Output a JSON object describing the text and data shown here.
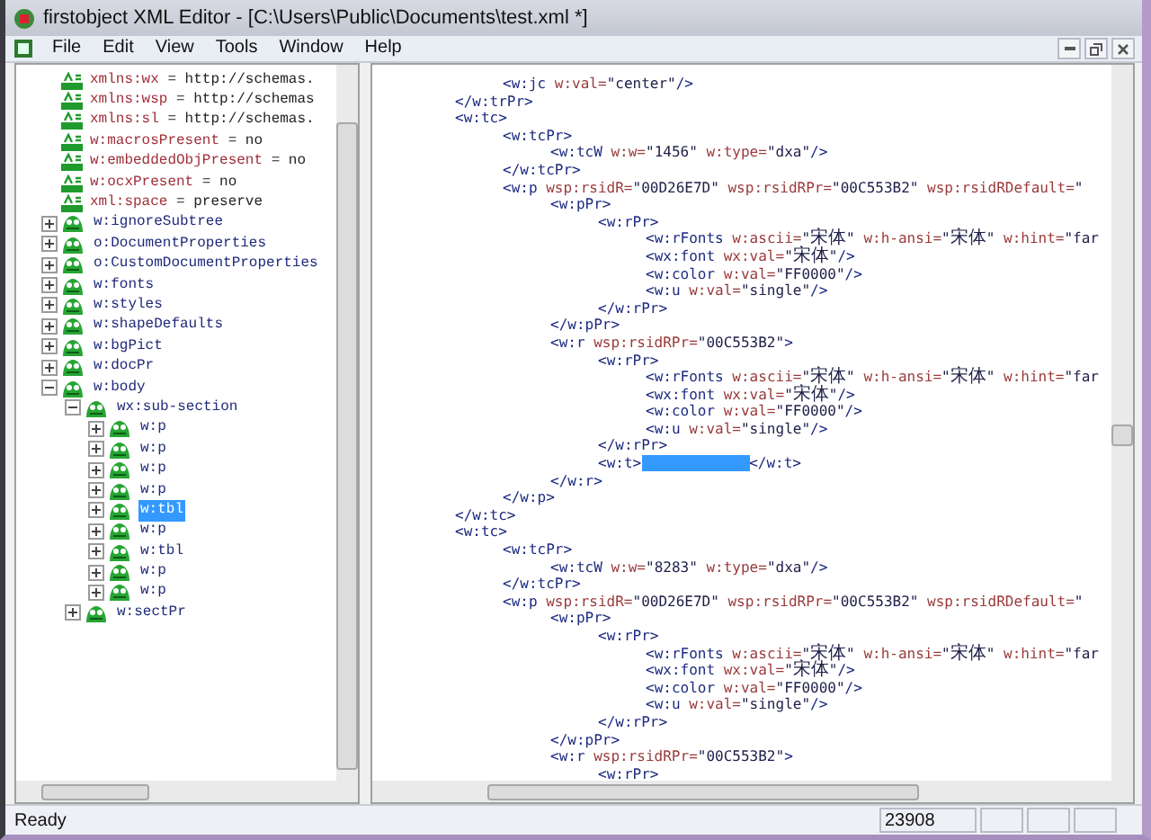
{
  "window": {
    "title": "firstobject XML Editor - [C:\\Users\\Public\\Documents\\test.xml *]"
  },
  "menu": [
    "File",
    "Edit",
    "View",
    "Tools",
    "Window",
    "Help"
  ],
  "tree": [
    {
      "kind": "attribute",
      "name": "xmlns:wx",
      "value": " = http://schemas."
    },
    {
      "kind": "attribute",
      "name": "xmlns:wsp",
      "value": " = http://schemas"
    },
    {
      "kind": "attribute",
      "name": "xmlns:sl",
      "value": " = http://schemas."
    },
    {
      "kind": "attribute",
      "name": "w:macrosPresent",
      "value": " = no"
    },
    {
      "kind": "attribute",
      "name": "w:embeddedObjPresent",
      "value": " = no"
    },
    {
      "kind": "attribute",
      "name": "w:ocxPresent",
      "value": " = no"
    },
    {
      "kind": "attribute",
      "name": "xml:space",
      "value": " = preserve"
    },
    {
      "kind": "element",
      "label": "w:ignoreSubtree",
      "expanded": false,
      "selected": false
    },
    {
      "kind": "element",
      "label": "o:DocumentProperties",
      "expanded": false,
      "selected": false
    },
    {
      "kind": "element",
      "label": "o:CustomDocumentProperties",
      "expanded": false,
      "selected": false
    },
    {
      "kind": "element",
      "label": "w:fonts",
      "expanded": false,
      "selected": false
    },
    {
      "kind": "element",
      "label": "w:styles",
      "expanded": false,
      "selected": false
    },
    {
      "kind": "element",
      "label": "w:shapeDefaults",
      "expanded": false,
      "selected": false
    },
    {
      "kind": "element",
      "label": "w:bgPict",
      "expanded": false,
      "selected": false
    },
    {
      "kind": "element",
      "label": "w:docPr",
      "expanded": false,
      "selected": false
    },
    {
      "kind": "element",
      "label": "w:body",
      "expanded": true,
      "selected": false,
      "children": [
        {
          "kind": "element",
          "label": "wx:sub-section",
          "expanded": true,
          "selected": false,
          "children": [
            {
              "kind": "element",
              "label": "w:p",
              "expanded": false,
              "selected": false
            },
            {
              "kind": "element",
              "label": "w:p",
              "expanded": false,
              "selected": false
            },
            {
              "kind": "element",
              "label": "w:p",
              "expanded": false,
              "selected": false
            },
            {
              "kind": "element",
              "label": "w:p",
              "expanded": false,
              "selected": false
            },
            {
              "kind": "element",
              "label": "w:tbl",
              "expanded": false,
              "selected": true
            },
            {
              "kind": "element",
              "label": "w:p",
              "expanded": false,
              "selected": false
            },
            {
              "kind": "element",
              "label": "w:tbl",
              "expanded": false,
              "selected": false
            },
            {
              "kind": "element",
              "label": "w:p",
              "expanded": false,
              "selected": false
            },
            {
              "kind": "element",
              "label": "w:p",
              "expanded": false,
              "selected": false
            }
          ]
        },
        {
          "kind": "element",
          "label": "w:sectPr",
          "expanded": false,
          "selected": false
        }
      ]
    }
  ],
  "code_lines": [
    {
      "children": [
        {
          "tokens": [
            {
              "kind": "tag",
              "text": "<w:jc"
            },
            {
              "kind": "attr",
              "text": " w:val="
            },
            {
              "kind": "value",
              "text": "\"center\""
            },
            {
              "kind": "tag",
              "text": "/>"
            }
          ]
        }
      ]
    },
    {
      "tokens": [
        {
          "kind": "tag",
          "text": "</w:trPr>"
        }
      ]
    },
    {
      "tokens": [
        {
          "kind": "tag",
          "text": "<w:tc>"
        }
      ],
      "children": [
        {
          "tokens": [
            {
              "kind": "tag",
              "text": "<w:tcPr>"
            }
          ],
          "children": [
            {
              "tokens": [
                {
                  "kind": "tag",
                  "text": "<w:tcW"
                },
                {
                  "kind": "attr",
                  "text": " w:w="
                },
                {
                  "kind": "value",
                  "text": "\"1456\""
                },
                {
                  "kind": "attr",
                  "text": " w:type="
                },
                {
                  "kind": "value",
                  "text": "\"dxa\""
                },
                {
                  "kind": "tag",
                  "text": "/>"
                }
              ]
            }
          ]
        },
        {
          "tokens": [
            {
              "kind": "tag",
              "text": "</w:tcPr>"
            }
          ]
        },
        {
          "tokens": [
            {
              "kind": "tag",
              "text": "<w:p"
            },
            {
              "kind": "attr",
              "text": " wsp:rsidR="
            },
            {
              "kind": "value",
              "text": "\"00D26E7D\""
            },
            {
              "kind": "attr",
              "text": " wsp:rsidRPr="
            },
            {
              "kind": "value",
              "text": "\"00C553B2\""
            },
            {
              "kind": "attr",
              "text": " wsp:rsidRDefault="
            },
            {
              "kind": "value",
              "text": "\""
            }
          ],
          "children": [
            {
              "tokens": [
                {
                  "kind": "tag",
                  "text": "<w:pPr>"
                }
              ],
              "children": [
                {
                  "tokens": [
                    {
                      "kind": "tag",
                      "text": "<w:rPr>"
                    }
                  ],
                  "children": [
                    {
                      "tokens": [
                        {
                          "kind": "tag",
                          "text": "<w:rFonts"
                        },
                        {
                          "kind": "attr",
                          "text": " w:ascii="
                        },
                        {
                          "kind": "value",
                          "text": "\""
                        },
                        {
                          "kind": "cjk",
                          "text": "宋体"
                        },
                        {
                          "kind": "value",
                          "text": "\""
                        },
                        {
                          "kind": "attr",
                          "text": " w:h-ansi="
                        },
                        {
                          "kind": "value",
                          "text": "\""
                        },
                        {
                          "kind": "cjk",
                          "text": "宋体"
                        },
                        {
                          "kind": "value",
                          "text": "\""
                        },
                        {
                          "kind": "attr",
                          "text": " w:hint="
                        },
                        {
                          "kind": "value",
                          "text": "\"far"
                        }
                      ]
                    },
                    {
                      "tokens": [
                        {
                          "kind": "tag",
                          "text": "<wx:font"
                        },
                        {
                          "kind": "attr",
                          "text": " wx:val="
                        },
                        {
                          "kind": "value",
                          "text": "\""
                        },
                        {
                          "kind": "cjk",
                          "text": "宋体"
                        },
                        {
                          "kind": "value",
                          "text": "\""
                        },
                        {
                          "kind": "tag",
                          "text": "/>"
                        }
                      ]
                    },
                    {
                      "tokens": [
                        {
                          "kind": "tag",
                          "text": "<w:color"
                        },
                        {
                          "kind": "attr",
                          "text": " w:val="
                        },
                        {
                          "kind": "value",
                          "text": "\"FF0000\""
                        },
                        {
                          "kind": "tag",
                          "text": "/>"
                        }
                      ]
                    },
                    {
                      "tokens": [
                        {
                          "kind": "tag",
                          "text": "<w:u"
                        },
                        {
                          "kind": "attr",
                          "text": " w:val="
                        },
                        {
                          "kind": "value",
                          "text": "\"single\""
                        },
                        {
                          "kind": "tag",
                          "text": "/>"
                        }
                      ]
                    }
                  ]
                },
                {
                  "tokens": [
                    {
                      "kind": "tag",
                      "text": "</w:rPr>"
                    }
                  ]
                }
              ]
            },
            {
              "tokens": [
                {
                  "kind": "tag",
                  "text": "</w:pPr>"
                }
              ]
            },
            {
              "tokens": [
                {
                  "kind": "tag",
                  "text": "<w:r"
                },
                {
                  "kind": "attr",
                  "text": " wsp:rsidRPr="
                },
                {
                  "kind": "value",
                  "text": "\"00C553B2\""
                },
                {
                  "kind": "tag",
                  "text": ">"
                }
              ],
              "children": [
                {
                  "tokens": [
                    {
                      "kind": "tag",
                      "text": "<w:rPr>"
                    }
                  ],
                  "children": [
                    {
                      "tokens": [
                        {
                          "kind": "tag",
                          "text": "<w:rFonts"
                        },
                        {
                          "kind": "attr",
                          "text": " w:ascii="
                        },
                        {
                          "kind": "value",
                          "text": "\""
                        },
                        {
                          "kind": "cjk",
                          "text": "宋体"
                        },
                        {
                          "kind": "value",
                          "text": "\""
                        },
                        {
                          "kind": "attr",
                          "text": " w:h-ansi="
                        },
                        {
                          "kind": "value",
                          "text": "\""
                        },
                        {
                          "kind": "cjk",
                          "text": "宋体"
                        },
                        {
                          "kind": "value",
                          "text": "\""
                        },
                        {
                          "kind": "attr",
                          "text": " w:hint="
                        },
                        {
                          "kind": "value",
                          "text": "\"far"
                        }
                      ]
                    },
                    {
                      "tokens": [
                        {
                          "kind": "tag",
                          "text": "<wx:font"
                        },
                        {
                          "kind": "attr",
                          "text": " wx:val="
                        },
                        {
                          "kind": "value",
                          "text": "\""
                        },
                        {
                          "kind": "cjk",
                          "text": "宋体"
                        },
                        {
                          "kind": "value",
                          "text": "\""
                        },
                        {
                          "kind": "tag",
                          "text": "/>"
                        }
                      ]
                    },
                    {
                      "tokens": [
                        {
                          "kind": "tag",
                          "text": "<w:color"
                        },
                        {
                          "kind": "attr",
                          "text": " w:val="
                        },
                        {
                          "kind": "value",
                          "text": "\"FF0000\""
                        },
                        {
                          "kind": "tag",
                          "text": "/>"
                        }
                      ]
                    },
                    {
                      "tokens": [
                        {
                          "kind": "tag",
                          "text": "<w:u"
                        },
                        {
                          "kind": "attr",
                          "text": " w:val="
                        },
                        {
                          "kind": "value",
                          "text": "\"single\""
                        },
                        {
                          "kind": "tag",
                          "text": "/>"
                        }
                      ]
                    }
                  ]
                },
                {
                  "tokens": [
                    {
                      "kind": "tag",
                      "text": "</w:rPr>"
                    }
                  ]
                },
                {
                  "tokens": [
                    {
                      "kind": "tag",
                      "text": "<w:t>"
                    },
                    {
                      "kind": "selection"
                    },
                    {
                      "kind": "tag",
                      "text": "</w:t>"
                    }
                  ]
                }
              ]
            },
            {
              "tokens": [
                {
                  "kind": "tag",
                  "text": "</w:r>"
                }
              ]
            }
          ]
        },
        {
          "tokens": [
            {
              "kind": "tag",
              "text": "</w:p>"
            }
          ]
        }
      ]
    },
    {
      "tokens": [
        {
          "kind": "tag",
          "text": "</w:tc>"
        }
      ]
    },
    {
      "tokens": [
        {
          "kind": "tag",
          "text": "<w:tc>"
        }
      ],
      "children": [
        {
          "tokens": [
            {
              "kind": "tag",
              "text": "<w:tcPr>"
            }
          ],
          "children": [
            {
              "tokens": [
                {
                  "kind": "tag",
                  "text": "<w:tcW"
                },
                {
                  "kind": "attr",
                  "text": " w:w="
                },
                {
                  "kind": "value",
                  "text": "\"8283\""
                },
                {
                  "kind": "attr",
                  "text": " w:type="
                },
                {
                  "kind": "value",
                  "text": "\"dxa\""
                },
                {
                  "kind": "tag",
                  "text": "/>"
                }
              ]
            }
          ]
        },
        {
          "tokens": [
            {
              "kind": "tag",
              "text": "</w:tcPr>"
            }
          ]
        },
        {
          "tokens": [
            {
              "kind": "tag",
              "text": "<w:p"
            },
            {
              "kind": "attr",
              "text": " wsp:rsidR="
            },
            {
              "kind": "value",
              "text": "\"00D26E7D\""
            },
            {
              "kind": "attr",
              "text": " wsp:rsidRPr="
            },
            {
              "kind": "value",
              "text": "\"00C553B2\""
            },
            {
              "kind": "attr",
              "text": " wsp:rsidRDefault="
            },
            {
              "kind": "value",
              "text": "\""
            }
          ],
          "children": [
            {
              "tokens": [
                {
                  "kind": "tag",
                  "text": "<w:pPr>"
                }
              ],
              "children": [
                {
                  "tokens": [
                    {
                      "kind": "tag",
                      "text": "<w:rPr>"
                    }
                  ],
                  "children": [
                    {
                      "tokens": [
                        {
                          "kind": "tag",
                          "text": "<w:rFonts"
                        },
                        {
                          "kind": "attr",
                          "text": " w:ascii="
                        },
                        {
                          "kind": "value",
                          "text": "\""
                        },
                        {
                          "kind": "cjk",
                          "text": "宋体"
                        },
                        {
                          "kind": "value",
                          "text": "\""
                        },
                        {
                          "kind": "attr",
                          "text": " w:h-ansi="
                        },
                        {
                          "kind": "value",
                          "text": "\""
                        },
                        {
                          "kind": "cjk",
                          "text": "宋体"
                        },
                        {
                          "kind": "value",
                          "text": "\""
                        },
                        {
                          "kind": "attr",
                          "text": " w:hint="
                        },
                        {
                          "kind": "value",
                          "text": "\"far"
                        }
                      ]
                    },
                    {
                      "tokens": [
                        {
                          "kind": "tag",
                          "text": "<wx:font"
                        },
                        {
                          "kind": "attr",
                          "text": " wx:val="
                        },
                        {
                          "kind": "value",
                          "text": "\""
                        },
                        {
                          "kind": "cjk",
                          "text": "宋体"
                        },
                        {
                          "kind": "value",
                          "text": "\""
                        },
                        {
                          "kind": "tag",
                          "text": "/>"
                        }
                      ]
                    },
                    {
                      "tokens": [
                        {
                          "kind": "tag",
                          "text": "<w:color"
                        },
                        {
                          "kind": "attr",
                          "text": " w:val="
                        },
                        {
                          "kind": "value",
                          "text": "\"FF0000\""
                        },
                        {
                          "kind": "tag",
                          "text": "/>"
                        }
                      ]
                    },
                    {
                      "tokens": [
                        {
                          "kind": "tag",
                          "text": "<w:u"
                        },
                        {
                          "kind": "attr",
                          "text": " w:val="
                        },
                        {
                          "kind": "value",
                          "text": "\"single\""
                        },
                        {
                          "kind": "tag",
                          "text": "/>"
                        }
                      ]
                    }
                  ]
                },
                {
                  "tokens": [
                    {
                      "kind": "tag",
                      "text": "</w:rPr>"
                    }
                  ]
                }
              ]
            },
            {
              "tokens": [
                {
                  "kind": "tag",
                  "text": "</w:pPr>"
                }
              ]
            },
            {
              "tokens": [
                {
                  "kind": "tag",
                  "text": "<w:r"
                },
                {
                  "kind": "attr",
                  "text": " wsp:rsidRPr="
                },
                {
                  "kind": "value",
                  "text": "\"00C553B2\""
                },
                {
                  "kind": "tag",
                  "text": ">"
                }
              ],
              "children": [
                {
                  "tokens": [
                    {
                      "kind": "tag",
                      "text": "<w:rPr>"
                    }
                  ]
                }
              ]
            }
          ]
        }
      ]
    }
  ],
  "status_bar": {
    "message": "Ready",
    "panes": [
      "23908"
    ]
  }
}
